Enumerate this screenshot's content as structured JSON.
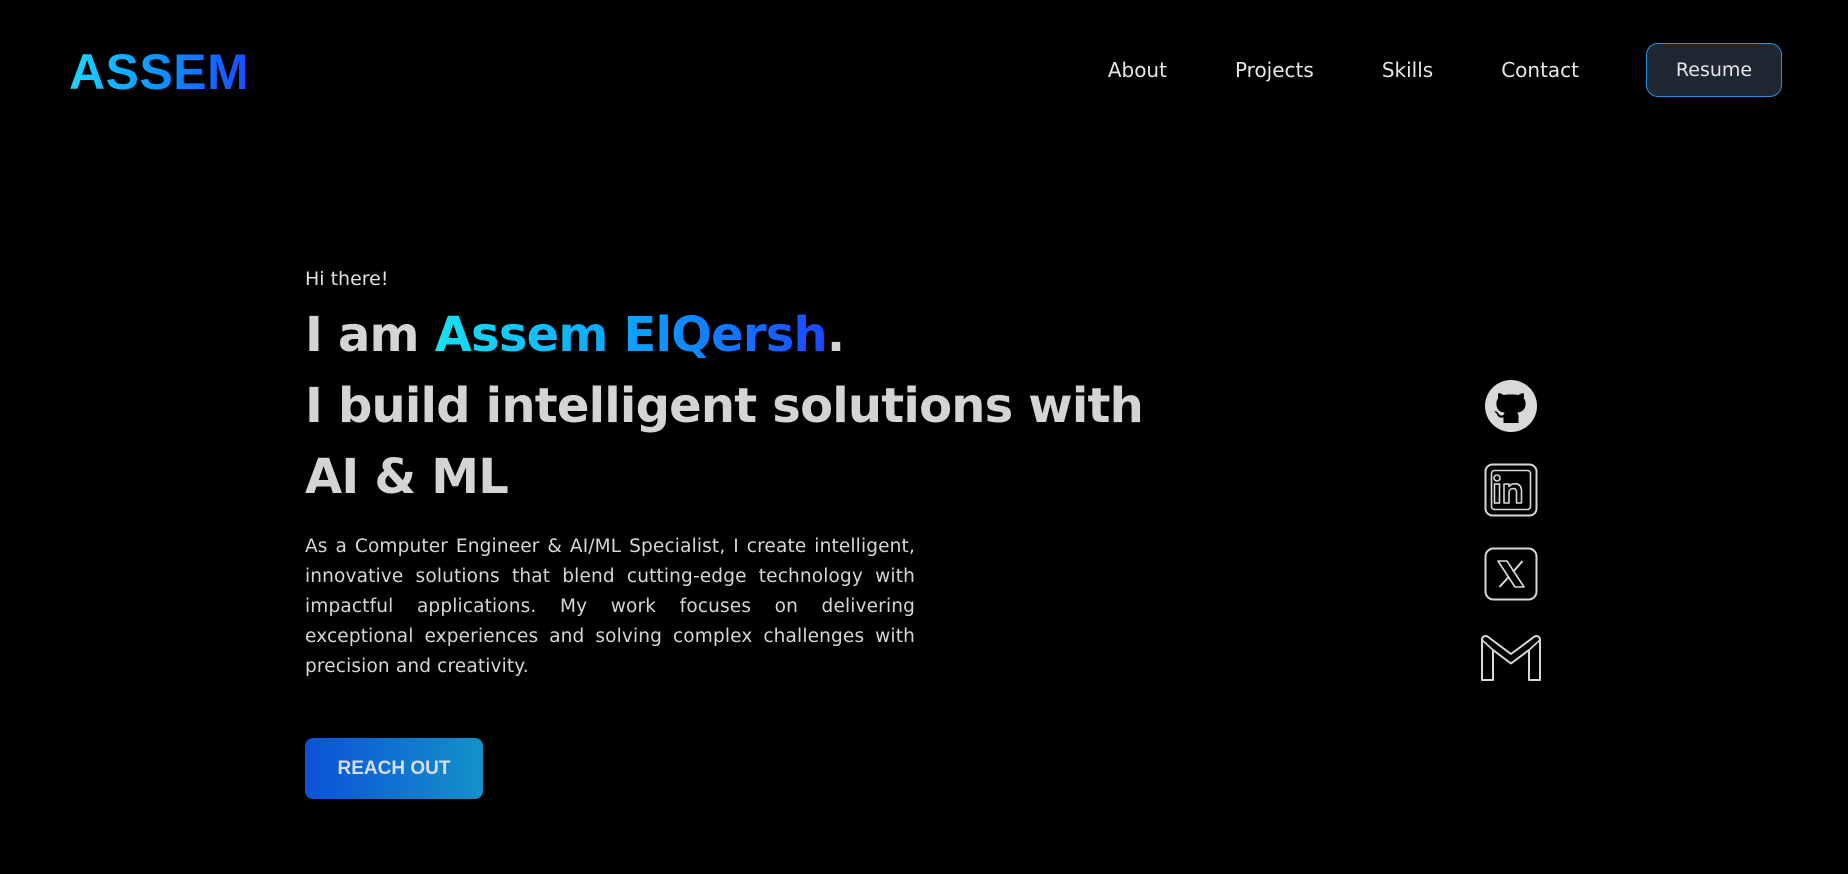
{
  "header": {
    "logo": "ASSEM",
    "nav": [
      {
        "label": "About"
      },
      {
        "label": "Projects"
      },
      {
        "label": "Skills"
      },
      {
        "label": "Contact"
      }
    ],
    "resume_label": "Resume"
  },
  "hero": {
    "greeting": "Hi there!",
    "headline_prefix": "I am ",
    "name": "Assem ElQersh",
    "headline_suffix": ".",
    "headline_line2": "I build intelligent solutions with",
    "headline_line3": "AI & ML",
    "intro": "As a Computer Engineer & AI/ML Specialist, I create intelligent, innovative solutions that blend cutting-edge technology with impactful applications. My work focuses on delivering exceptional experiences and solving complex challenges with precision and creativity.",
    "cta_label": "REACH OUT"
  },
  "socials": [
    {
      "icon": "github-icon"
    },
    {
      "icon": "linkedin-icon"
    },
    {
      "icon": "x-icon"
    },
    {
      "icon": "gmail-icon"
    }
  ],
  "colors": {
    "background": "#000000",
    "accent_start": "#18e0f0",
    "accent_end": "#1d48ff",
    "resume_border": "#2a8fe0",
    "cta_start": "#0b52d6",
    "cta_end": "#1392c9"
  }
}
